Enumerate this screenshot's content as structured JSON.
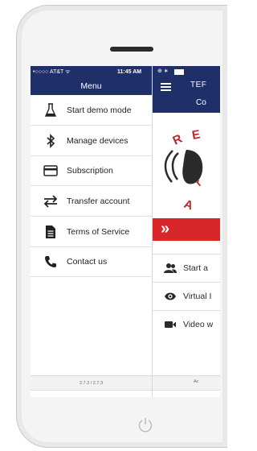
{
  "menu": {
    "status": {
      "carrier": "•○○○○ AT&T ᯤ",
      "time": "11:45 AM"
    },
    "title": "Menu",
    "items": [
      {
        "label": "Start demo mode",
        "icon": "flask-icon"
      },
      {
        "label": "Manage devices",
        "icon": "bluetooth-icon"
      },
      {
        "label": "Subscription",
        "icon": "credit-card-icon"
      },
      {
        "label": "Transfer account",
        "icon": "transfer-arrows-icon"
      },
      {
        "label": "Terms of Service",
        "icon": "document-icon"
      },
      {
        "label": "Contact us",
        "icon": "phone-icon"
      }
    ],
    "footer": "2.7.3 / 2.7.3"
  },
  "main": {
    "status": {
      "icons": "⊕ ∗"
    },
    "title": "TEF",
    "subheader": "Co",
    "actions": [
      {
        "label": "Start a",
        "icon": "users-icon"
      },
      {
        "label": "Virtual I",
        "icon": "eye-icon"
      },
      {
        "label": "Video w",
        "icon": "video-camera-icon"
      }
    ],
    "footer": "Ac"
  },
  "colors": {
    "nav_bg": "#1f2f6a",
    "accent_red": "#d8262b"
  }
}
